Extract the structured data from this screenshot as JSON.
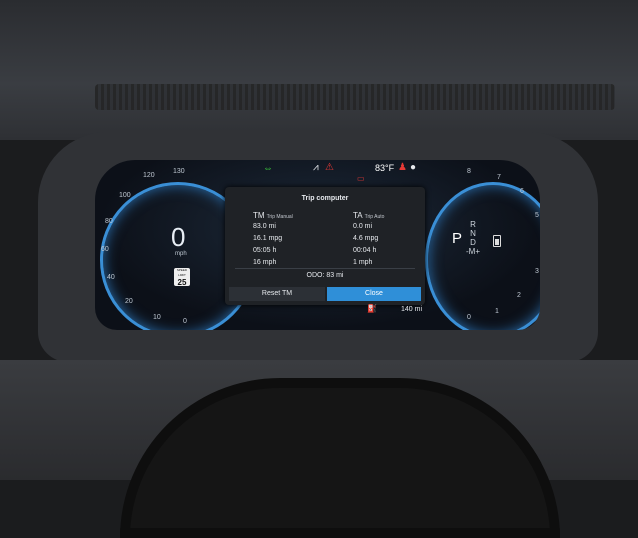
{
  "status": {
    "outside_temp": "83°F",
    "colors": {
      "green": "#3ccf3c",
      "red": "#e53935",
      "white": "#e6e9ed",
      "accent": "#2f8fd8"
    },
    "icons": [
      "lane-assist-icon",
      "warning-triangle-icon",
      "battery-warning-icon",
      "seatbelt-warning-icon"
    ]
  },
  "speedometer": {
    "speed": "0",
    "unit": "mph",
    "scale": [
      "0",
      "10",
      "20",
      "40",
      "60",
      "80",
      "100",
      "120",
      "130"
    ],
    "speed_limit_label": "SPEED LIMIT",
    "speed_limit_value": "25"
  },
  "tachometer": {
    "scale": [
      "0",
      "1",
      "2",
      "3",
      "4",
      "5",
      "6",
      "7",
      "8"
    ],
    "gear": "P",
    "gear_list": [
      "R",
      "N",
      "D",
      "-M+"
    ]
  },
  "trip_computer": {
    "title": "Trip computer",
    "tm_code": "TM",
    "tm_label": "Trip Manual",
    "ta_code": "TA",
    "ta_label": "Trip Auto",
    "tm_values": [
      "83.0 mi",
      "16.1 mpg",
      "05:05 h",
      "16 mph"
    ],
    "ta_values": [
      "0.0 mi",
      "4.6 mpg",
      "00:04 h",
      "1 mph"
    ],
    "odo": "ODO:  83 mi",
    "reset_label": "Reset TM",
    "close_label": "Close"
  },
  "bottom_bar": {
    "range": "140 mi"
  }
}
